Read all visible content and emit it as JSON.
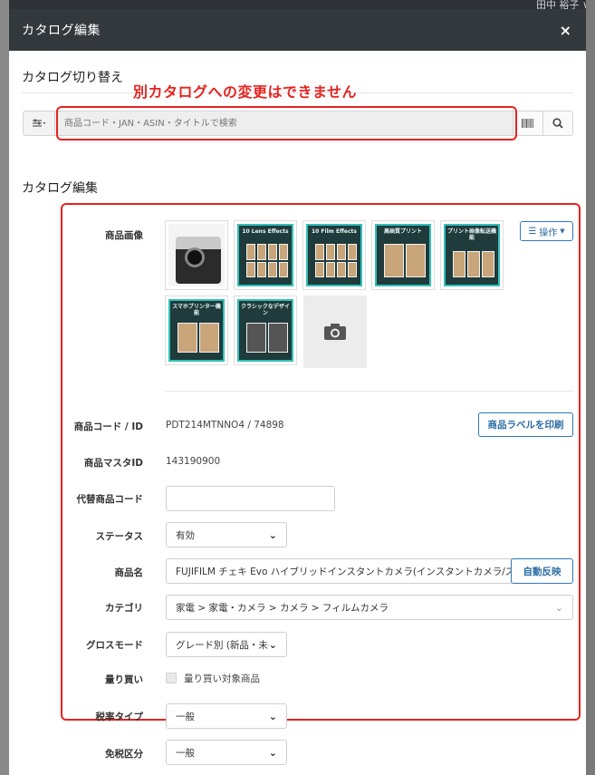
{
  "background": {
    "user_name": "田中 裕子 ∨"
  },
  "modal": {
    "title": "カタログ編集",
    "close": "×"
  },
  "catalog_switch": {
    "title": "カタログ切り替え",
    "annotation": "別カタログへの変更はできません",
    "filter_icon": "sliders-icon",
    "search_placeholder": "商品コード・JAN・ASIN・タイトルで検索"
  },
  "catalog_edit": {
    "title": "カタログ編集",
    "image_label": "商品画像",
    "operation_button": "操作",
    "thumbnails": [
      {
        "title": ""
      },
      {
        "title": "10 Lens Effects"
      },
      {
        "title": "10 Film Effects"
      },
      {
        "title": "高画質プリント"
      },
      {
        "title": "プリント画像転送機能"
      },
      {
        "title": "スマホプリンター機能"
      },
      {
        "title": "クラシックなデザイン"
      }
    ],
    "code_label": "商品コード / ID",
    "code_value": "PDT214MTNNO4 / 74898",
    "print_label_button": "商品ラベルを印刷",
    "master_label": "商品マスタID",
    "master_value": "143190900",
    "alt_code_label": "代替商品コード",
    "alt_code_value": "",
    "status_label": "ステータス",
    "status_value": "有効",
    "name_label": "商品名",
    "name_value": "FUJIFILM チェキ Evo ハイブリッドインスタントカメラ(インスタントカメラ/スマホプリンター",
    "auto_button": "自動反映",
    "category_label": "カテゴリ",
    "category_value": "家電 > 家電・カメラ > カメラ > フィルムカメラ",
    "gross_label": "グロスモード",
    "gross_value": "グレード別 (新品・未(",
    "split_label": "量り買い",
    "split_checkbox_label": "量り買い対象商品",
    "tax_type_label": "税率タイプ",
    "tax_type_value": "一般",
    "tax_free_label": "免税区分",
    "tax_free_value": "一般"
  },
  "colors": {
    "header_bg": "#33383c",
    "annotation_red": "#e6231f",
    "button_blue": "#2b7bbf",
    "thumb_teal": "#32c0b9"
  }
}
